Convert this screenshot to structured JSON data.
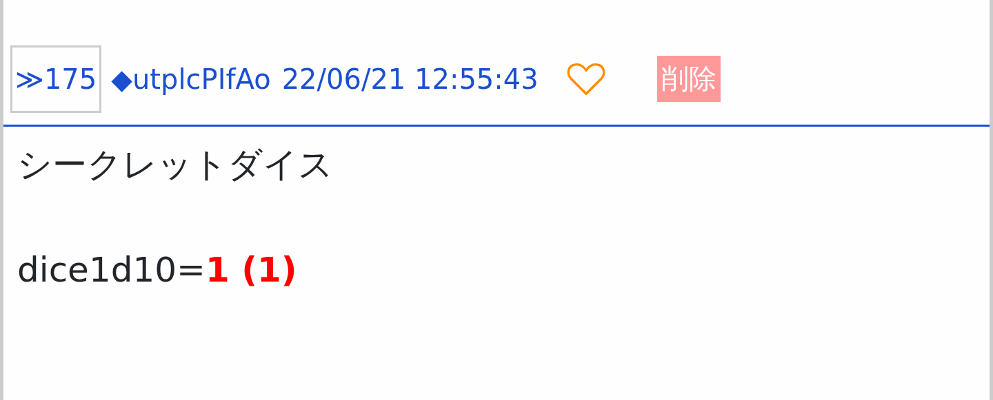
{
  "post": {
    "number": "≫175",
    "author": "◆utplcPIfAo",
    "timestamp": "22/06/21 12:55:43",
    "liked": false,
    "delete_label": "削除"
  },
  "body": {
    "lines": [
      {
        "kind": "text",
        "text": "シークレットダイス"
      },
      {
        "kind": "dice",
        "expression": "dice1d10=",
        "result": "1 (1)"
      }
    ]
  }
}
